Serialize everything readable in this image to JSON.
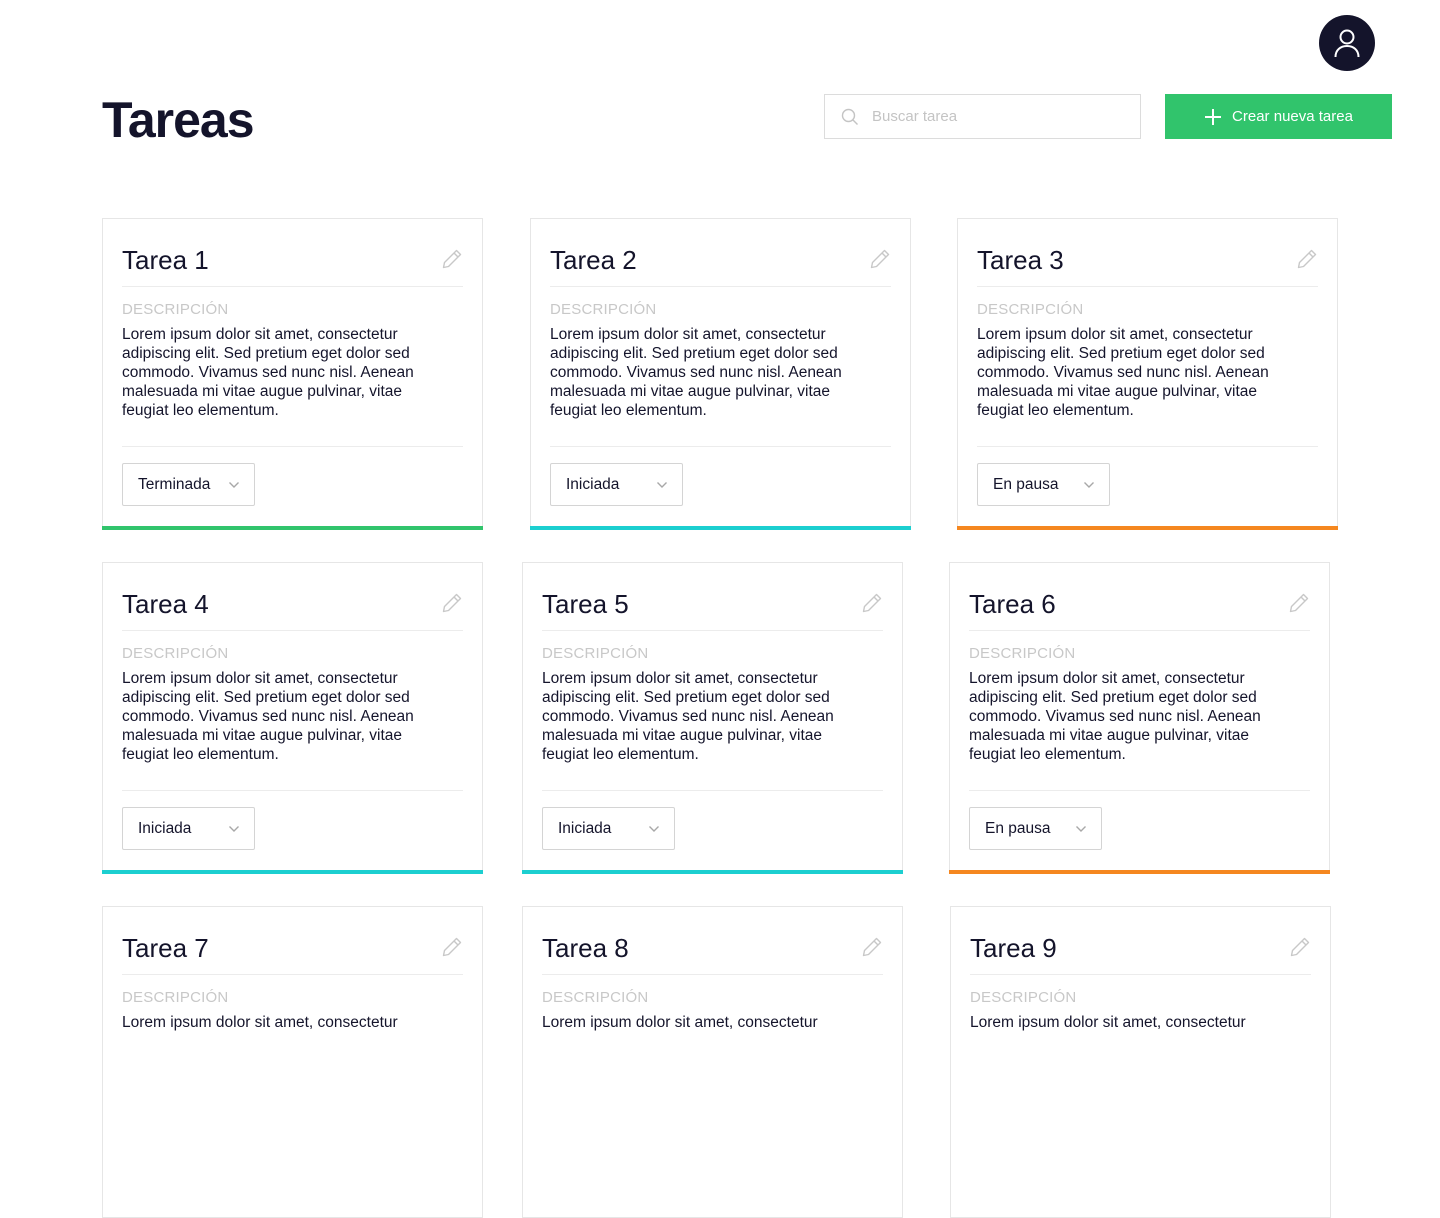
{
  "header": {
    "title": "Tareas",
    "search_placeholder": "Buscar tarea",
    "search_value": "",
    "create_button_label": "Crear nueva tarea"
  },
  "colors": {
    "primary_dark": "#14142b",
    "create_button": "#31c46c",
    "status_terminada": "#31c46c",
    "status_iniciada": "#1ccfd0",
    "status_en_pausa": "#f5871f"
  },
  "tasks": [
    {
      "title": "Tarea 1",
      "desc_label": "DESCRIPCIÓN",
      "description": "Lorem ipsum dolor sit amet, consectetur adipiscing elit. Sed pretium eget dolor sed commodo. Vivamus sed nunc nisl. Aenean malesuada mi vitae augue pulvinar, vitae feugiat leo elementum.",
      "status": "Terminada",
      "status_color": "#31c46c"
    },
    {
      "title": "Tarea 2",
      "desc_label": "DESCRIPCIÓN",
      "description": "Lorem ipsum dolor sit amet, consectetur adipiscing elit. Sed pretium eget dolor sed commodo. Vivamus sed nunc nisl. Aenean malesuada mi vitae augue pulvinar, vitae feugiat leo elementum.",
      "status": "Iniciada",
      "status_color": "#1ccfd0"
    },
    {
      "title": "Tarea 3",
      "desc_label": "DESCRIPCIÓN",
      "description": "Lorem ipsum dolor sit amet, consectetur adipiscing elit. Sed pretium eget dolor sed commodo. Vivamus sed nunc nisl. Aenean malesuada mi vitae augue pulvinar, vitae feugiat leo elementum.",
      "status": "En pausa",
      "status_color": "#f5871f"
    },
    {
      "title": "Tarea 4",
      "desc_label": "DESCRIPCIÓN",
      "description": "Lorem ipsum dolor sit amet, consectetur adipiscing elit. Sed pretium eget dolor sed commodo. Vivamus sed nunc nisl. Aenean malesuada mi vitae augue pulvinar, vitae feugiat leo elementum.",
      "status": "Iniciada",
      "status_color": "#1ccfd0"
    },
    {
      "title": "Tarea 5",
      "desc_label": "DESCRIPCIÓN",
      "description": "Lorem ipsum dolor sit amet, consectetur adipiscing elit. Sed pretium eget dolor sed commodo. Vivamus sed nunc nisl. Aenean malesuada mi vitae augue pulvinar, vitae feugiat leo elementum.",
      "status": "Iniciada",
      "status_color": "#1ccfd0"
    },
    {
      "title": "Tarea 6",
      "desc_label": "DESCRIPCIÓN",
      "description": "Lorem ipsum dolor sit amet, consectetur adipiscing elit. Sed pretium eget dolor sed commodo. Vivamus sed nunc nisl. Aenean malesuada mi vitae augue pulvinar, vitae feugiat leo elementum.",
      "status": "En pausa",
      "status_color": "#f5871f"
    },
    {
      "title": "Tarea 7",
      "desc_label": "DESCRIPCIÓN",
      "description": "Lorem ipsum dolor sit amet, consectetur",
      "status": "",
      "status_color": ""
    },
    {
      "title": "Tarea 8",
      "desc_label": "DESCRIPCIÓN",
      "description": "Lorem ipsum dolor sit amet, consectetur",
      "status": "",
      "status_color": ""
    },
    {
      "title": "Tarea 9",
      "desc_label": "DESCRIPCIÓN",
      "description": "Lorem ipsum dolor sit amet, consectetur",
      "status": "",
      "status_color": ""
    }
  ]
}
